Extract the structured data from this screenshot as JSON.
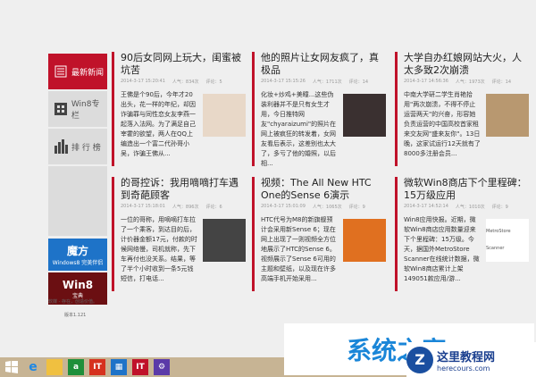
{
  "sidebar": {
    "items": [
      {
        "label": "最新新闻",
        "icon": "newspaper-icon"
      },
      {
        "label": "Win8专栏",
        "icon": "windows-icon"
      },
      {
        "label": "排 行 榜",
        "icon": "bar-chart-icon"
      }
    ],
    "promos": [
      {
        "title": "魔方",
        "subtitle": "Windows8 完美伴侣"
      },
      {
        "title": "Win8",
        "subtitle": "宝典"
      }
    ],
    "slogan": "软媒 - 存在，创造价值。",
    "version": "版本1.121"
  },
  "articles": [
    {
      "title": "90后女同网上玩大，闺蜜被坑苦",
      "time": "2014-3-17 15:20:41",
      "views": "人气：834次",
      "comments": "评论：5",
      "text": "王佛是个90后，今年才20出头，花一样的年纪，却因诈骗罪与同性恋女友李燕一起落入法网。为了满足自己宰霍的欲望，两人在QQ上编造出一个富二代孙哥小吴，诈骗王佛从..."
    },
    {
      "title": "他的照片让女网友疯了，真极品",
      "time": "2014-3-17 15:15:26",
      "views": "人气：1711次",
      "comments": "评论：14",
      "text": "化妆+炒鸡+美瞳...这些伪装利器并不是只有女生才用，今日推特网友\"chyaraizumi\"的照片在网上被疯狂的转发着，女网友看后表示，这差别也太大了，多亏了他的婚照，以后相..."
    },
    {
      "title": "大学自办红娘网站大火，人太多致2次崩溃",
      "time": "2014-3-17 14:56:36",
      "views": "人气：1973次",
      "comments": "评论：14",
      "text": "中南大学研二学生肖艳拾用\"两次崩溃，不得不停止运营两天\"的兴奋，形容她负责运营的中国高校首家租来交友网\"盛来友你\"。13日晚，这家试运行12天就有了8000多注册会员..."
    },
    {
      "title": "的哥控诉：我用嘀嘀打车遇到奇葩顾客",
      "time": "2014-3-17 15:18:01",
      "views": "人气：896次",
      "comments": "评论：6",
      "text": "一位的哥称，用嘀嘀打车拉了一个乘客，到达目的后，计价器金额17元，付款的时候网络慢，司机就称，先下车再付也没关系。结果，等了半个小时收到一条5元钱短信，打电话..."
    },
    {
      "title": "视频：The All New HTC One的Sense 6演示",
      "time": "2014-3-17 15:01:09",
      "views": "人气：1065次",
      "comments": "评论：9",
      "text": "HTC代号为M8的新旗舰预计会采用新Sense 6；现在网上出现了一则视频全方位地展示了HTC的Sense 6。视频展示了Sense 6可用的主题和壁纸，以及现在许多高端手机开始采用..."
    },
    {
      "title": "微软Win8商店下个里程碑：15万级应用",
      "time": "2014-3-17 14:52:14",
      "views": "人气：1010次",
      "comments": "评论：9",
      "text": "Win8应用快报。近期，微软Win8商店应用数量迎来下个里程碑：15万级。今天，据国外MetroStore Scanner在线统计数据，微软Win8商店累计上架149051款应用/游..."
    }
  ],
  "image_caption": "MetroStore Scanner",
  "watermark": {
    "text": "系统之家",
    "site": "这里教程网",
    "url": "herecours.com"
  },
  "taskbar": [
    "start",
    "ie",
    "explorer",
    "store",
    "ithome",
    "mofang",
    "ithome2",
    "settings"
  ]
}
